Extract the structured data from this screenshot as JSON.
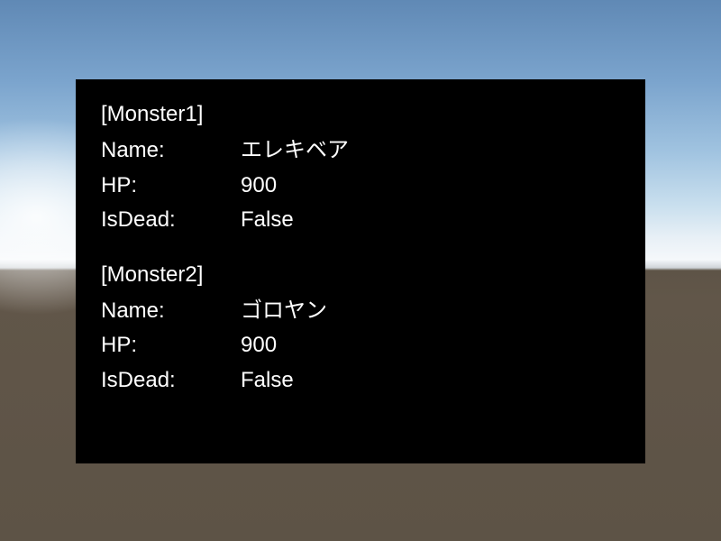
{
  "monsters": [
    {
      "header": "[Monster1]",
      "name_label": "Name:",
      "name_value": "エレキベア",
      "hp_label": "HP:",
      "hp_value": "900",
      "isdead_label": "IsDead:",
      "isdead_value": "False"
    },
    {
      "header": "[Monster2]",
      "name_label": "Name:",
      "name_value": "ゴロヤン",
      "hp_label": "HP:",
      "hp_value": "900",
      "isdead_label": "IsDead:",
      "isdead_value": "False"
    }
  ]
}
